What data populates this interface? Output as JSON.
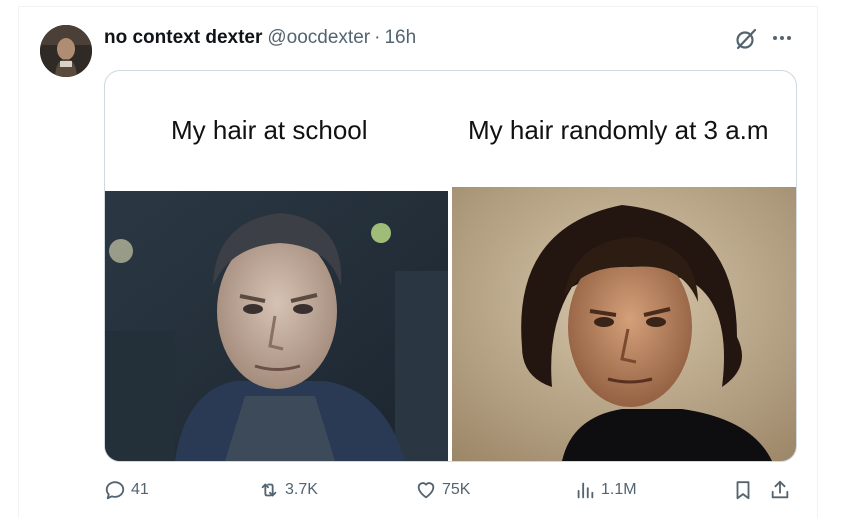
{
  "tweet": {
    "display_name": "no context dexter",
    "handle": "@oocdexter",
    "separator": "·",
    "time": "16h"
  },
  "media": {
    "caption_left": "My hair at school",
    "caption_right": "My hair randomly at 3 a.m"
  },
  "actions": {
    "replies": "41",
    "reposts": "3.7K",
    "likes": "75K",
    "views": "1.1M"
  },
  "icons": [
    "grok-icon",
    "more-icon",
    "reply-icon",
    "repost-icon",
    "like-icon",
    "views-icon",
    "bookmark-icon",
    "share-icon"
  ],
  "colors": {
    "text": "#0f1419",
    "secondary": "#536471",
    "border": "#cfd9de"
  }
}
